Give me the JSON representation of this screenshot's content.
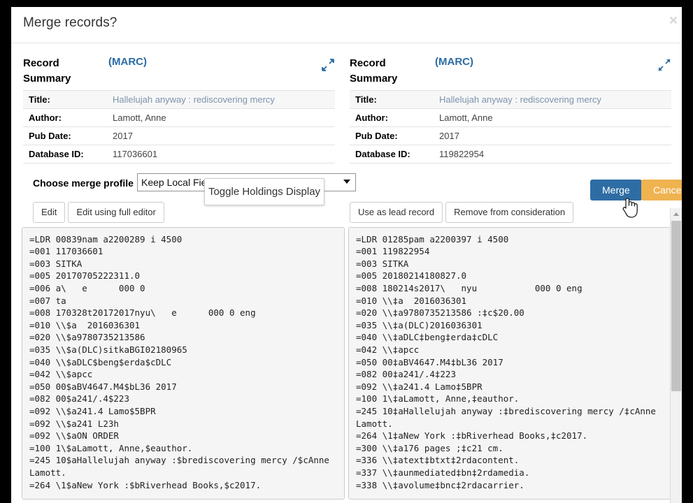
{
  "dialog": {
    "title": "Merge records?",
    "close_icon": "close-icon"
  },
  "records": [
    {
      "heading": "Record Summary",
      "marc_link": "(MARC)",
      "expand_icon": "expand-arrows-icon",
      "fields": [
        {
          "key": "Title:",
          "value": "Hallelujah anyway : rediscovering mercy"
        },
        {
          "key": "Author:",
          "value": "Lamott, Anne"
        },
        {
          "key": "Pub Date:",
          "value": "2017"
        },
        {
          "key": "Database ID:",
          "value": "117036601"
        }
      ],
      "toolbar": [
        "Edit",
        "Edit using full editor"
      ],
      "marc": "=LDR 00839nam a2200289 i 4500\n=001 117036601\n=003 SITKA\n=005 20170705222311.0\n=006 a\\   e      000 0\n=007 ta\n=008 170328t20172017nyu\\   e      000 0 eng\n=010 \\\\$a  2016036301\n=020 \\\\$a9780735213586\n=035 \\\\$a(DLC)sitkaBGI02180965\n=040 \\\\$aDLC$beng$erda$cDLC\n=042 \\\\$apcc\n=050 00$aBV4647.M4$bL36 2017\n=082 00$a241/.4$223\n=092 \\\\$a241.4 Lamo$5BPR\n=092 \\\\$a241 L23h\n=092 \\\\$aON ORDER\n=100 1\\$aLamott, Anne,$eauthor.\n=245 10$aHallelujah anyway :$brediscovering mercy /$cAnne Lamott.\n=264 \\1$aNew York :$bRiverhead Books,$c2017."
    },
    {
      "heading": "Record Summary",
      "marc_link": "(MARC)",
      "expand_icon": "expand-arrows-icon",
      "fields": [
        {
          "key": "Title:",
          "value": "Hallelujah anyway : rediscovering mercy"
        },
        {
          "key": "Author:",
          "value": "Lamott, Anne"
        },
        {
          "key": "Pub Date:",
          "value": "2017"
        },
        {
          "key": "Database ID:",
          "value": "119822954"
        }
      ],
      "toolbar": [
        "Use as lead record",
        "Remove from consideration"
      ],
      "marc": "=LDR 01285pam a2200397 i 4500\n=001 119822954\n=003 SITKA\n=005 20180214180827.0\n=008 180214s2017\\   nyu           000 0 eng\n=010 \\\\‡a  2016036301\n=020 \\\\‡a9780735213586 :‡c$20.00\n=035 \\\\‡a(DLC)2016036301\n=040 \\\\‡aDLC‡beng‡erda‡cDLC\n=042 \\\\‡apcc\n=050 00‡aBV4647.M4‡bL36 2017\n=082 00‡a241/.4‡223\n=092 \\\\‡a241.4 Lamo‡5BPR\n=100 1\\‡aLamott, Anne,‡eauthor.\n=245 10‡aHallelujah anyway :‡brediscovering mercy /‡cAnne Lamott.\n=264 \\1‡aNew York :‡bRiverhead Books,‡c2017.\n=300 \\\\‡a176 pages ;‡c21 cm.\n=336 \\\\‡atext‡btxt‡2rdacontent.\n=337 \\\\‡aunmediated‡bn‡2rdamedia.\n=338 \\\\‡avolume‡bnc‡2rdacarrier."
    }
  ],
  "merge_profile": {
    "label": "Choose merge profile",
    "selected": "Keep Local Fie",
    "caret_icon": "chevron-down-icon"
  },
  "tooltip": {
    "text": "Toggle Holdings Display"
  },
  "actions": {
    "merge_label": "Merge",
    "cancel_label": "Cancel"
  },
  "colors": {
    "merge_button": "#2e6da4",
    "cancel_button": "#efb350",
    "link": "#2b6ca3",
    "title_value": "#7b93ab"
  },
  "scrollbar": {
    "up_arrow_icon": "scroll-up-arrow-icon"
  },
  "cursor": {
    "icon": "pointing-hand-cursor"
  }
}
